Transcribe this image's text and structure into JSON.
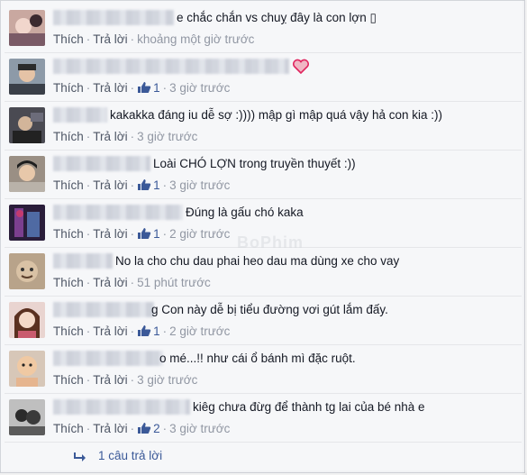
{
  "actions": {
    "like_label": "Thích",
    "reply_label": "Trả lời",
    "separator": "·"
  },
  "comments": [
    {
      "text": "e chắc chắn vs chuỵ đây là con lợn ▯",
      "likes": "",
      "time": "khoảng một giờ trước"
    },
    {
      "text": "",
      "likes": "1",
      "time": "3 giờ trước"
    },
    {
      "text": "kakakka đáng iu dễ sợ :)))) mập gì mập quá vậy hả con kia :))",
      "likes": "",
      "time": "3 giờ trước"
    },
    {
      "text": "Loài CHÓ LỢN trong truyền thuyết :))",
      "likes": "1",
      "time": "3 giờ trước"
    },
    {
      "text": "Đúng là gấu chó kaka",
      "likes": "1",
      "time": "2 giờ trước"
    },
    {
      "text": "No la cho chu dau phai heo dau ma dùng xe cho vay",
      "likes": "",
      "time": "51 phút trước"
    },
    {
      "text": "g Con này dễ bị tiểu đường vơi gút lắm đấy.",
      "likes": "1",
      "time": "2 giờ trước"
    },
    {
      "text": "o mé...!! như cái ổ bánh mì đặc ruột.",
      "likes": "",
      "time": "3 giờ trước"
    },
    {
      "text": "kiêg chưa đừg để thành tg lai của bé nhà e",
      "likes": "2",
      "time": "3 giờ trước"
    }
  ],
  "reply_link": "1 câu trả lời",
  "watermark": "BoPhim",
  "colors": {
    "link": "#3b5998",
    "meta": "#9197a3",
    "heart": "#e0245e"
  }
}
